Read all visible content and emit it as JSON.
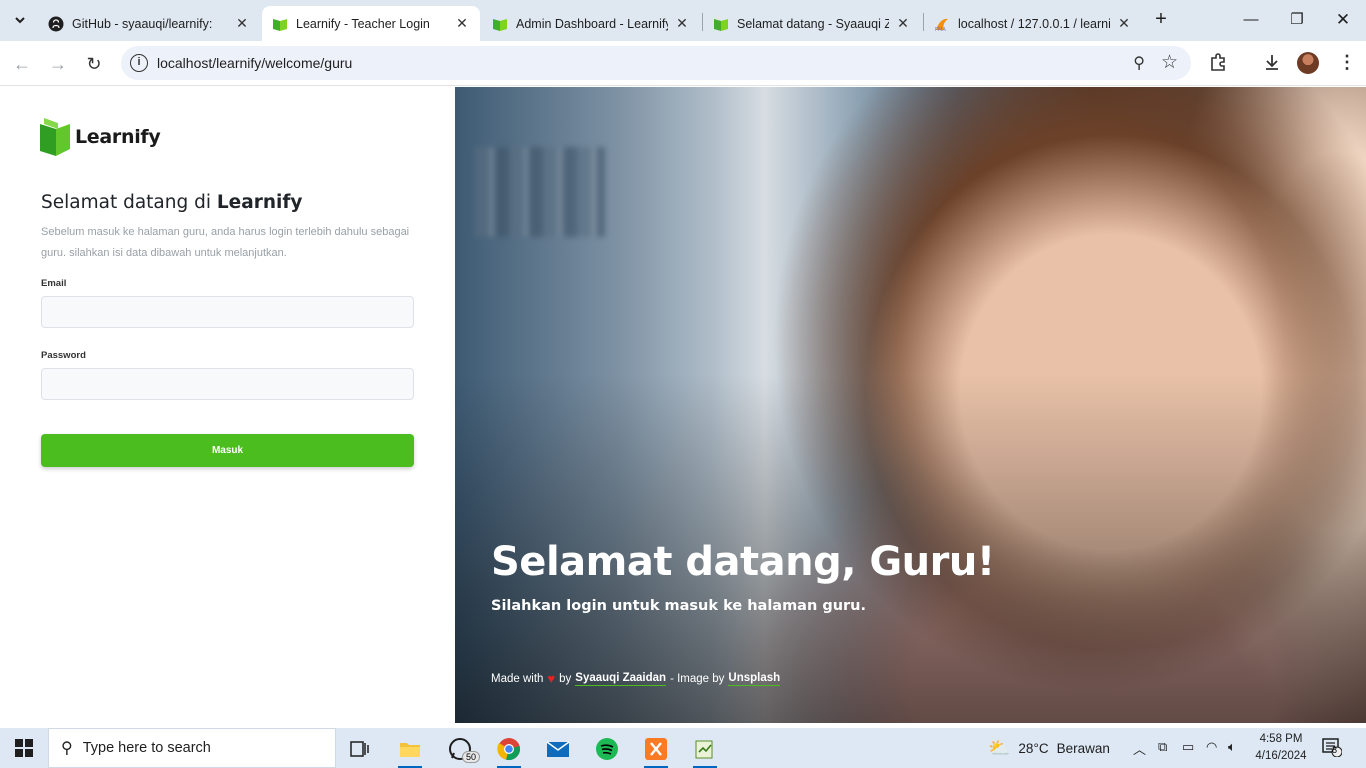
{
  "browser": {
    "tabs": [
      {
        "title": "GitHub - syaauqi/learnify:",
        "icon": "github-icon"
      },
      {
        "title": "Learnify - Teacher Login",
        "icon": "learnify-icon"
      },
      {
        "title": "Admin Dashboard - Learnify",
        "icon": "learnify-icon"
      },
      {
        "title": "Selamat datang - Syaauqi Za",
        "icon": "learnify-icon"
      },
      {
        "title": "localhost / 127.0.0.1 / learnif",
        "icon": "phpmyadmin-icon"
      }
    ],
    "active_tab_index": 1,
    "url": "localhost/learnify/welcome/guru"
  },
  "login": {
    "brand": "Learnify",
    "heading_prefix": "Selamat datang di",
    "heading_brand": "Learnify",
    "description": "Sebelum masuk ke halaman guru, anda harus login terlebih dahulu sebagai guru. silahkan isi data dibawah untuk melanjutkan.",
    "email_label": "Email",
    "email_value": "",
    "password_label": "Password",
    "password_value": "",
    "submit_label": "Masuk"
  },
  "hero": {
    "title": "Selamat datang, Guru!",
    "subtitle": "Silahkan login untuk masuk ke halaman guru.",
    "credit_made_with": "Made with",
    "credit_by": "by",
    "credit_author": "Syaauqi Zaaidan",
    "credit_image_by": "- Image by",
    "credit_source": "Unsplash"
  },
  "taskbar": {
    "search_placeholder": "Type here to search",
    "whatsapp_badge": "50",
    "weather_temp": "28°C",
    "weather_desc": "Berawan",
    "time": "4:58 PM",
    "date": "4/16/2024",
    "notification_count": "8"
  },
  "colors": {
    "brand_green": "#4cbd1f",
    "heart_red": "#e02424"
  }
}
